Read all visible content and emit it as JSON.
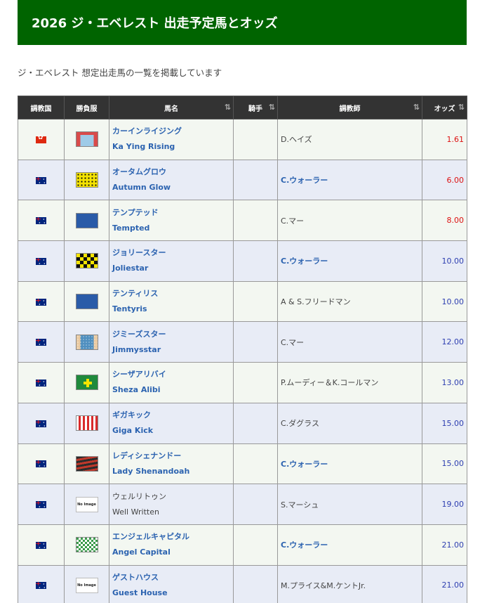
{
  "header": {
    "title": "2026 ジ・エベレスト 出走予定馬とオッズ"
  },
  "intro": "ジ・エベレスト 想定出走馬の一覧を掲載しています",
  "table": {
    "columns": {
      "country": "調教国",
      "silk": "勝負服",
      "horse": "馬名",
      "jockey": "騎手",
      "trainer": "調教師",
      "odds": "オッズ"
    },
    "sort_icon": "⇅",
    "no_image": "No Image",
    "rows": [
      {
        "flag": "hong-kong-flag-icon",
        "silk": "kaying",
        "name_jp": "カーインライジング",
        "name_en": "Ka Ying Rising",
        "name_link": true,
        "jockey": "",
        "trainer": "D.ヘイズ",
        "trainer_link": false,
        "odds": "1.61",
        "odds_low": true
      },
      {
        "flag": "australia-flag-icon",
        "silk": "autumn",
        "name_jp": "オータムグロウ",
        "name_en": "Autumn Glow",
        "name_link": true,
        "jockey": "",
        "trainer": "C.ウォーラー",
        "trainer_link": true,
        "odds": "6.00",
        "odds_low": true
      },
      {
        "flag": "australia-flag-icon",
        "silk": "blue",
        "name_jp": "テンプテッド",
        "name_en": "Tempted",
        "name_link": true,
        "jockey": "",
        "trainer": "C.マー",
        "trainer_link": false,
        "odds": "8.00",
        "odds_low": true
      },
      {
        "flag": "australia-flag-icon",
        "silk": "jolie",
        "name_jp": "ジョリースター",
        "name_en": "Joliestar",
        "name_link": true,
        "jockey": "",
        "trainer": "C.ウォーラー",
        "trainer_link": true,
        "odds": "10.00",
        "odds_low": false
      },
      {
        "flag": "australia-flag-icon",
        "silk": "blue",
        "name_jp": "テンティリス",
        "name_en": "Tentyris",
        "name_link": true,
        "jockey": "",
        "trainer": "A & S.フリードマン",
        "trainer_link": false,
        "odds": "10.00",
        "odds_low": false
      },
      {
        "flag": "australia-flag-icon",
        "silk": "jimmy",
        "name_jp": "ジミーズスター",
        "name_en": "Jimmysstar",
        "name_link": true,
        "jockey": "",
        "trainer": "C.マー",
        "trainer_link": false,
        "odds": "12.00",
        "odds_low": false
      },
      {
        "flag": "australia-flag-icon",
        "silk": "sheza",
        "name_jp": "シーザアリバイ",
        "name_en": "Sheza Alibi",
        "name_link": true,
        "jockey": "",
        "trainer": "P.ムーディー＆K.コールマン",
        "trainer_link": false,
        "odds": "13.00",
        "odds_low": false
      },
      {
        "flag": "australia-flag-icon",
        "silk": "giga",
        "name_jp": "ギガキック",
        "name_en": "Giga Kick",
        "name_link": true,
        "jockey": "",
        "trainer": "C.ダグラス",
        "trainer_link": false,
        "odds": "15.00",
        "odds_low": false
      },
      {
        "flag": "australia-flag-icon",
        "silk": "lady",
        "name_jp": "レディシェナンドー",
        "name_en": "Lady Shenandoah",
        "name_link": true,
        "jockey": "",
        "trainer": "C.ウォーラー",
        "trainer_link": true,
        "odds": "15.00",
        "odds_low": false
      },
      {
        "flag": "australia-flag-icon",
        "silk": "noimage",
        "name_jp": "ウェルリトゥン",
        "name_en": "Well Written",
        "name_link": false,
        "jockey": "",
        "trainer": "S.マーシュ",
        "trainer_link": false,
        "odds": "19.00",
        "odds_low": false
      },
      {
        "flag": "australia-flag-icon",
        "silk": "angel",
        "name_jp": "エンジェルキャピタル",
        "name_en": "Angel Capital",
        "name_link": true,
        "jockey": "",
        "trainer": "C.ウォーラー",
        "trainer_link": true,
        "odds": "21.00",
        "odds_low": false
      },
      {
        "flag": "australia-flag-icon",
        "silk": "noimage",
        "name_jp": "ゲストハウス",
        "name_en": "Guest House",
        "name_link": true,
        "jockey": "",
        "trainer": "M.プライス&M.ケントJr.",
        "trainer_link": false,
        "odds": "21.00",
        "odds_low": false
      }
    ]
  }
}
